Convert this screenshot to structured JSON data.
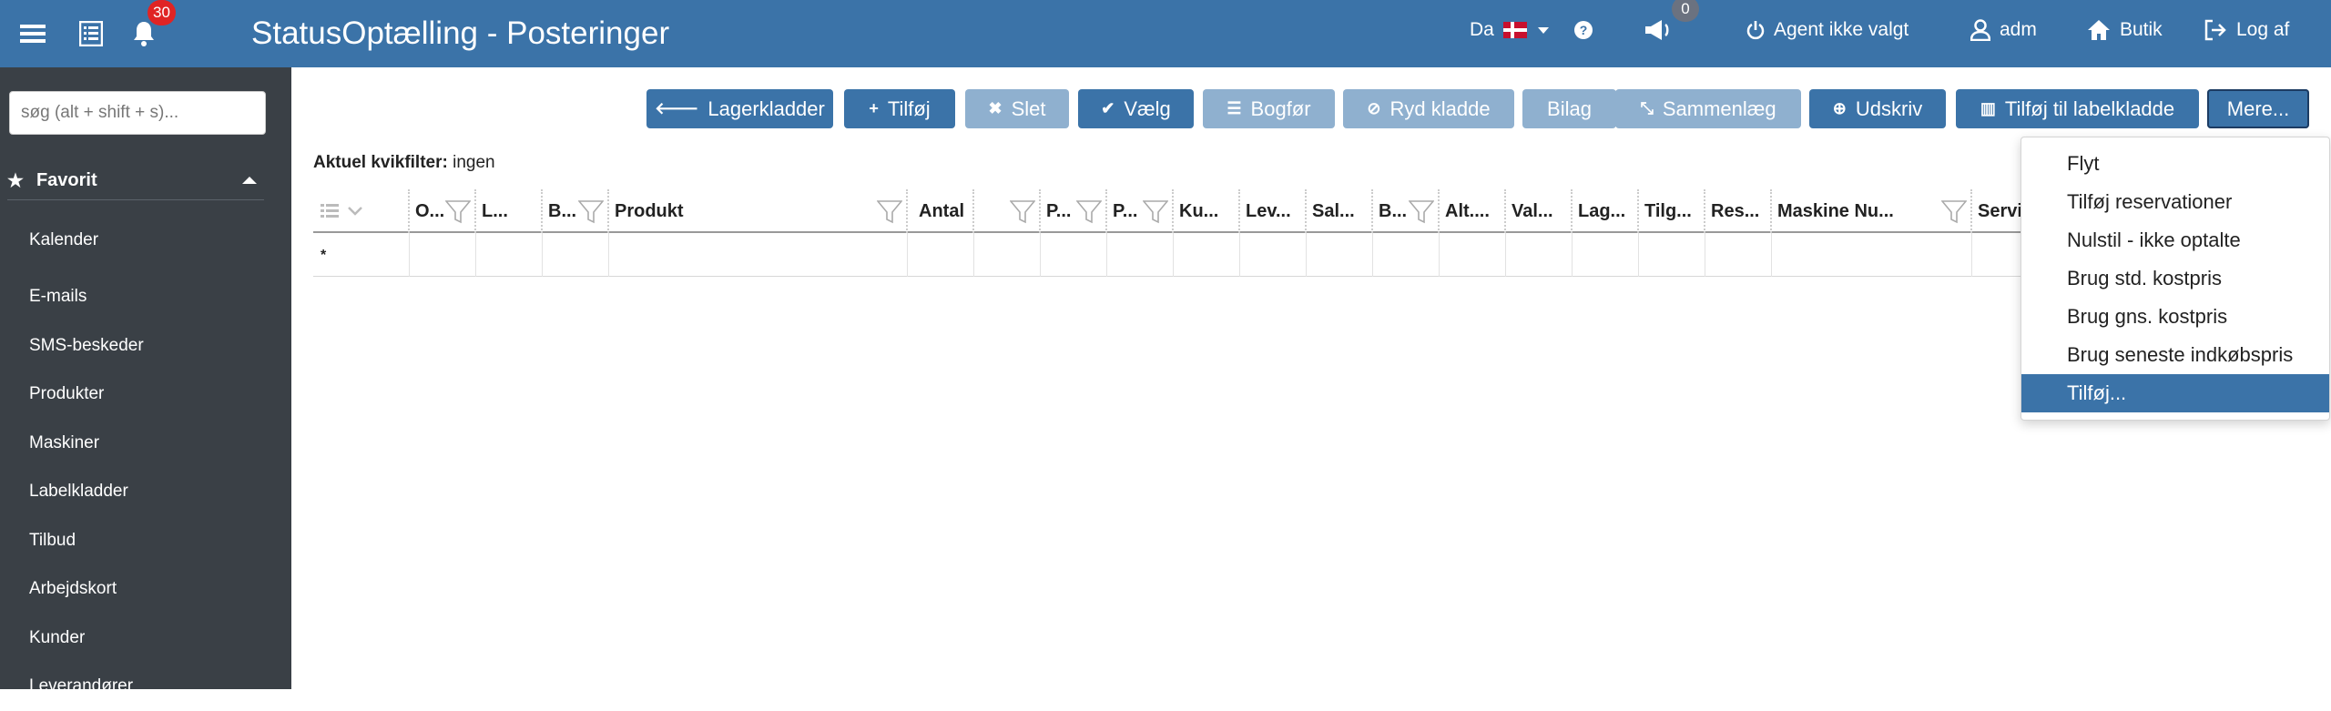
{
  "app": {
    "title": "StatusOptælling - Posteringer",
    "notification_count": "30",
    "announcement_count": "0",
    "language": "Da",
    "agent": "Agent ikke valgt",
    "user": "adm",
    "shop": "Butik",
    "logout": "Log af"
  },
  "sidebar": {
    "search_placeholder": "søg (alt + shift + s)...",
    "favorites_label": "Favorit",
    "items": [
      "Kalender",
      "E-mails",
      "SMS-beskeder",
      "Produkter",
      "Maskiner",
      "Labelkladder",
      "Tilbud",
      "Arbejdskort",
      "Kunder",
      "Leverandører"
    ]
  },
  "toolbar": {
    "buttons": [
      {
        "label": "Lagerkladder",
        "state": "primary"
      },
      {
        "label": "Tilføj",
        "state": "primary"
      },
      {
        "label": "Slet",
        "state": "disabled"
      },
      {
        "label": "Vælg",
        "state": "primary"
      },
      {
        "label": "Bogfør",
        "state": "disabled"
      },
      {
        "label": "Ryd kladde",
        "state": "disabled"
      },
      {
        "label": "Bilag",
        "state": "disabled"
      },
      {
        "label": "Sammenlæg",
        "state": "disabled"
      },
      {
        "label": "Udskriv",
        "state": "primary"
      },
      {
        "label": "Tilføj til labelkladde",
        "state": "primary"
      },
      {
        "label": "Mere...",
        "state": "outlined"
      }
    ]
  },
  "quickfilter": {
    "label": "Aktuel kvikfilter:",
    "value": "ingen"
  },
  "grid": {
    "columns": [
      "O...",
      "L...",
      "B...",
      "Produkt",
      "Antal",
      "",
      "P...",
      "P...",
      "Ku...",
      "Lev...",
      "Sal...",
      "B...",
      "Alt....",
      "Val...",
      "Lag...",
      "Tilg...",
      "Res...",
      "Maskine Nu...",
      "Servic"
    ],
    "new_row_marker": "*"
  },
  "menu": {
    "items": [
      {
        "label": "Flyt",
        "active": false
      },
      {
        "label": "Tilføj reservationer",
        "active": false
      },
      {
        "label": "Nulstil - ikke optalte",
        "active": false
      },
      {
        "label": "Brug std. kostpris",
        "active": false
      },
      {
        "label": "Brug gns. kostpris",
        "active": false
      },
      {
        "label": "Brug seneste indkøbspris",
        "active": false
      },
      {
        "label": "Tilføj...",
        "active": true
      }
    ]
  },
  "colors": {
    "topbar": "#3b73a8",
    "sidebar": "#3a4046",
    "button_primary": "#3b73a8",
    "button_disabled": "#8fb0cf",
    "badge_red": "#e02424"
  }
}
